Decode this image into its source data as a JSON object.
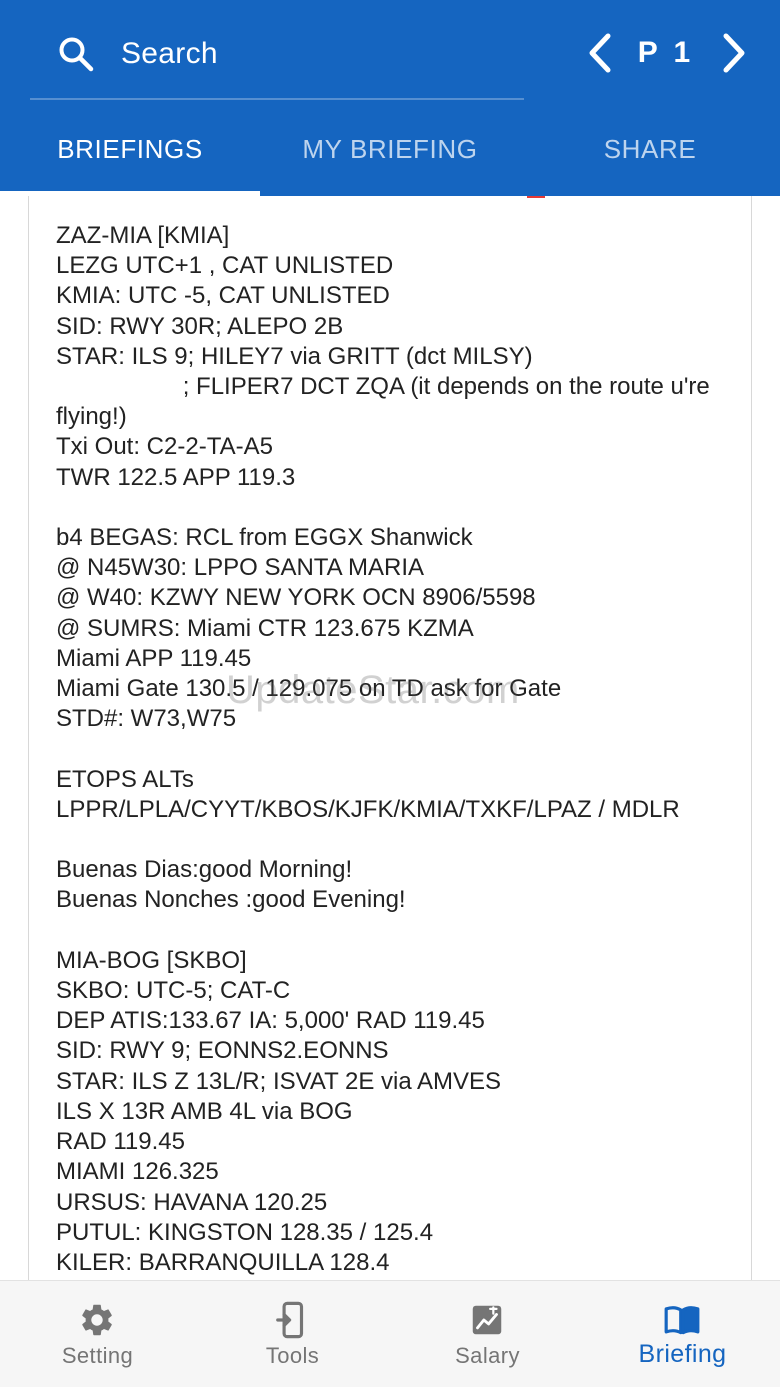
{
  "header": {
    "search_placeholder": "Search",
    "page_indicator": "P 1",
    "accent_color": "#1565c0"
  },
  "tabs": [
    {
      "label": "BRIEFINGS",
      "active": true
    },
    {
      "label": "MY BRIEFING",
      "active": false
    },
    {
      "label": "SHARE",
      "active": false
    }
  ],
  "briefing": {
    "text": "ZAZ-MIA [KMIA]\nLEZG UTC+1 , CAT UNLISTED\nKMIA: UTC -5, CAT UNLISTED\nSID: RWY 30R; ALEPO 2B\nSTAR: ILS 9; HILEY7 via GRITT (dct MILSY)\n                   ; FLIPER7 DCT ZQA (it depends on the route u're flying!)\nTxi Out: C2-2-TA-A5\nTWR 122.5 APP 119.3\n\nb4 BEGAS: RCL from EGGX Shanwick\n@ N45W30: LPPO SANTA MARIA\n@ W40: KZWY NEW YORK OCN 8906/5598\n@ SUMRS: Miami CTR 123.675 KZMA\nMiami APP 119.45\nMiami Gate 130.5 / 129.075 on TD ask for Gate\nSTD#: W73,W75\n\nETOPS ALTs\nLPPR/LPLA/CYYT/KBOS/KJFK/KMIA/TXKF/LPAZ / MDLR\n\nBuenas Dias:good Morning!\nBuenas Nonches :good Evening!\n\nMIA-BOG [SKBO]\nSKBO: UTC-5; CAT-C\nDEP ATIS:133.67 IA: 5,000' RAD 119.45\nSID: RWY 9; EONNS2.EONNS\nSTAR: ILS Z 13L/R; ISVAT 2E via AMVES\nILS X 13R AMB 4L via BOG\nRAD 119.45\nMIAMI 126.325\nURSUS: HAVANA 120.25\nPUTUL: KINGSTON 128.35 / 125.4\nKILER: BARRANQUILLA 128.4"
  },
  "watermark": "UpdateStar.com",
  "bottom_nav": [
    {
      "label": "Setting",
      "icon": "gear-icon",
      "active": false
    },
    {
      "label": "Tools",
      "icon": "tools-icon",
      "active": false
    },
    {
      "label": "Salary",
      "icon": "salary-icon",
      "active": false
    },
    {
      "label": "Briefing",
      "icon": "book-icon",
      "active": true
    }
  ]
}
